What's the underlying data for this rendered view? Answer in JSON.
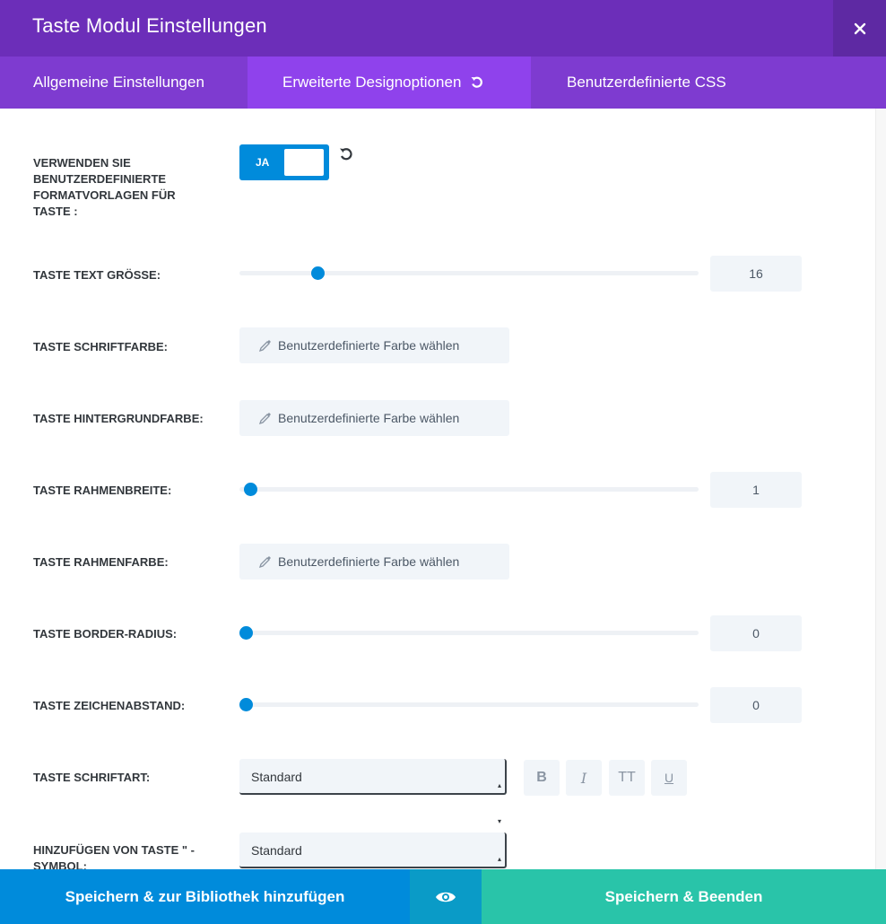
{
  "header": {
    "title": "Taste Modul Einstellungen",
    "close_icon": "close-icon"
  },
  "tabs": [
    {
      "label": "Allgemeine Einstellungen",
      "active": false
    },
    {
      "label": "Erweiterte Designoptionen",
      "active": true,
      "icon": "reset-icon"
    },
    {
      "label": "Benutzerdefinierte CSS",
      "active": false
    }
  ],
  "fields": {
    "custom_styles": {
      "label": "Verwenden Sie benutzerdefinierte Formatvorlagen für Taste :",
      "toggle_label": "JA",
      "on": true
    },
    "text_size": {
      "label": "Taste Text Grösse:",
      "value": "16",
      "fraction": 0.16
    },
    "text_color": {
      "label": "Taste Schriftfarbe:",
      "button_label": "Benutzerdefinierte Farbe wählen"
    },
    "bg_color": {
      "label": "Taste Hintergrundfarbe:",
      "button_label": "Benutzerdefinierte Farbe wählen"
    },
    "border_width": {
      "label": "Taste Rahmenbreite:",
      "value": "1",
      "fraction": 0.01
    },
    "border_color": {
      "label": "Taste Rahmenfarbe:",
      "button_label": "Benutzerdefinierte Farbe wählen"
    },
    "border_radius": {
      "label": "Taste Border-Radius:",
      "value": "0",
      "fraction": 0.0
    },
    "letter_spacing": {
      "label": "Taste Zeichenabstand:",
      "value": "0",
      "fraction": 0.0
    },
    "font": {
      "label": "Taste Schriftart:",
      "selected": "Standard",
      "styles": [
        "B",
        "I",
        "TT",
        "U"
      ]
    },
    "icon": {
      "label": "Hinzufügen von Taste \" - Symbol:",
      "selected": "Standard"
    }
  },
  "footer": {
    "save_library": "Speichern & zur Bibliothek hinzufügen",
    "preview_icon": "eye-icon",
    "save_exit": "Speichern & Beenden"
  },
  "colors": {
    "header": "#6c2eb9",
    "tabs": "#7e3bd0",
    "active_tab": "#8f42ec",
    "accent_blue": "#008bdb",
    "save_exit": "#29c4a9"
  }
}
